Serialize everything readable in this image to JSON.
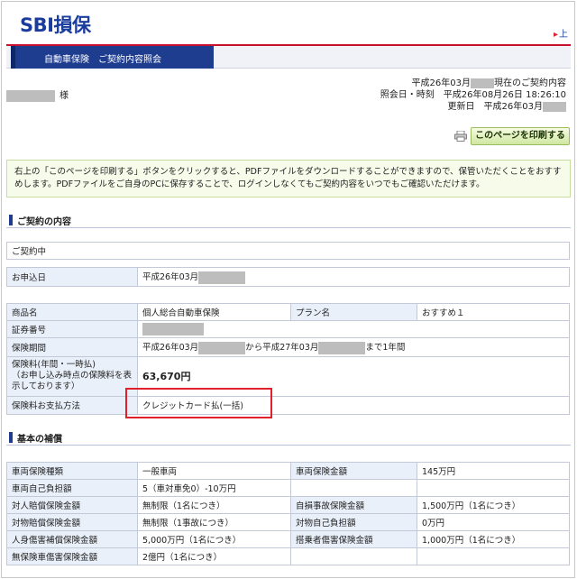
{
  "header": {
    "logo": "SBI損保",
    "top_link": "上",
    "tab": "自動車保険　ご契約内容照会",
    "line1_pre": "平成26年03月",
    "line1_post": "現在のご契約内容",
    "line2": "照会日・時刻　平成26年08月26日 18:26:10",
    "line3": "更新日　平成26年03月",
    "name_suffix": "様"
  },
  "print_button": "このページを印刷する",
  "notice": "右上の「このページを印刷する」ボタンをクリックすると、PDFファイルをダウンロードすることができますので、保管いただくことをおすすめします。PDFファイルをご自身のPCに保存することで、ログインしなくてもご契約内容をいつでもご確認いただけます。",
  "section1": {
    "title": "ご契約の内容",
    "status": "ご契約中",
    "apply_label": "お申込日",
    "apply_value": "平成26年03月",
    "rows": {
      "product_label": "商品名",
      "product_value": "個人総合自動車保険",
      "plan_label": "プラン名",
      "plan_value": "おすすめ１",
      "policy_label": "証券番号",
      "period_label": "保険期間",
      "period_a": "平成26年03月",
      "period_b": "から平成27年03月",
      "period_c": "まで1年間",
      "premium_label": "保険料(年間・一時払)\n（お申し込み時点の保険料を表示しております）",
      "premium_value": "63,670円",
      "payment_label": "保険料お支払方法",
      "payment_value": "クレジットカード払(一括)"
    }
  },
  "section2": {
    "title": "基本の補償",
    "rows": [
      [
        "車両保険種類",
        "一般車両",
        "車両保険金額",
        "145万円"
      ],
      [
        "車両自己負担額",
        "5（車対車免0）-10万円",
        "",
        ""
      ],
      [
        "対人賠償保険金額",
        "無制限（1名につき）",
        "自損事故保険金額",
        "1,500万円（1名につき）"
      ],
      [
        "対物賠償保険金額",
        "無制限（1事故につき）",
        "対物自己負担額",
        "0万円"
      ],
      [
        "人身傷害補償保険金額",
        "5,000万円（1名につき）",
        "搭乗者傷害保険金額",
        "1,000万円（1名につき）"
      ],
      [
        "無保険車傷害保険金額",
        "2億円（1名につき）",
        "",
        ""
      ]
    ]
  },
  "colors": {
    "brand": "#1f3d8f",
    "accent": "#c8102e",
    "highlight": "#e0202a"
  }
}
